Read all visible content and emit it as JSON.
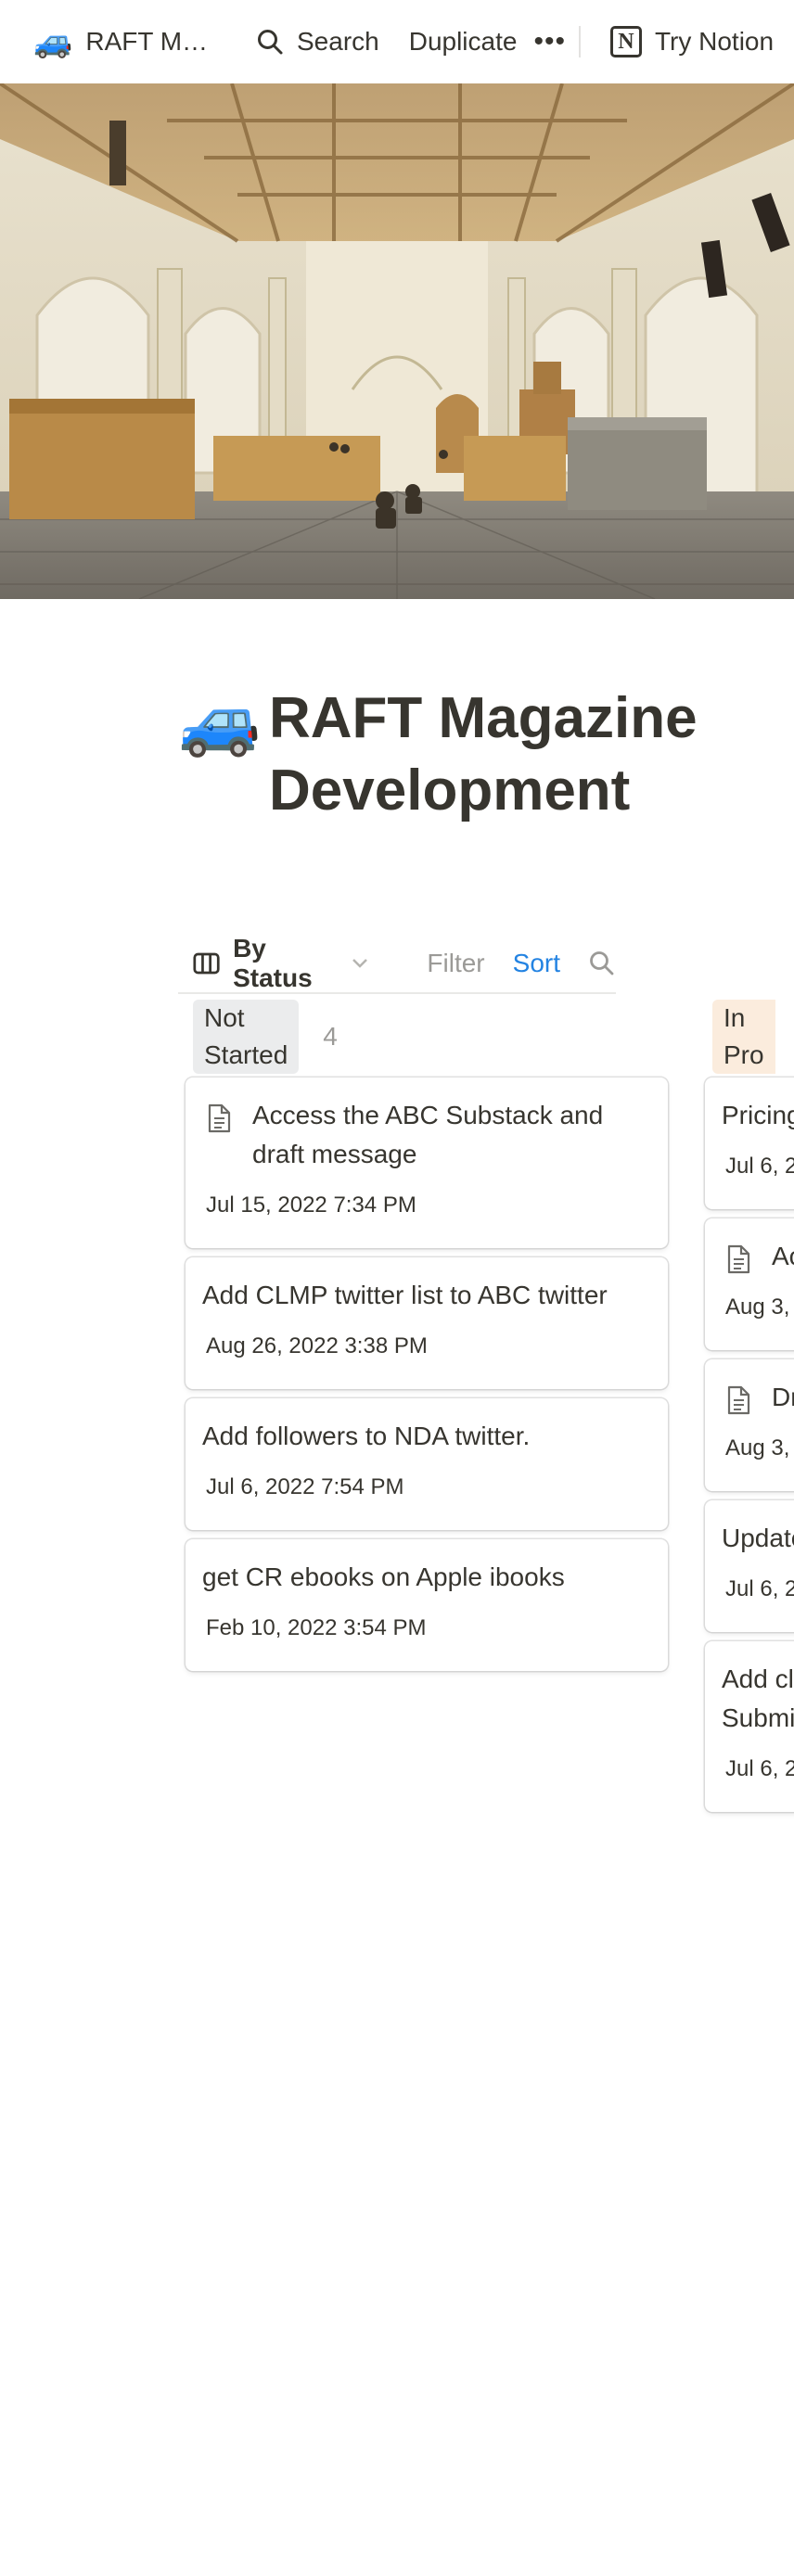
{
  "topbar": {
    "breadcrumb_emoji": "🚙",
    "breadcrumb_title": "RAFT M…",
    "search_label": "Search",
    "duplicate_label": "Duplicate",
    "more_label": "•••",
    "try_notion_label": "Try Notion",
    "notion_logo_letter": "N"
  },
  "cover": {
    "description_icon": "church-interior-painting"
  },
  "page": {
    "icon": "🚙",
    "title": "RAFT Magazine Development"
  },
  "viewbar": {
    "view_name": "By Status",
    "filter_label": "Filter",
    "sort_label": "Sort"
  },
  "board": {
    "groups": [
      {
        "status": "Not Started",
        "status_color": "#ebeced",
        "count": "4",
        "cards": [
          {
            "title": "Access the ABC Substack and draft message",
            "date": "Jul 15, 2022 7:34 PM",
            "has_doc_icon": true
          },
          {
            "title": "Add CLMP twitter list to ABC twitter",
            "date": "Aug 26, 2022 3:38 PM",
            "has_doc_icon": false
          },
          {
            "title": "Add followers to NDA twitter.",
            "date": "Jul 6, 2022 7:54 PM",
            "has_doc_icon": false
          },
          {
            "title": "get CR ebooks on Apple ibooks",
            "date": "Feb 10, 2022 3:54 PM",
            "has_doc_icon": false
          }
        ]
      },
      {
        "status": "In Pro",
        "status_color": "#fbecdd",
        "cards": [
          {
            "title": "Pricing",
            "date": "Jul 6, 2",
            "has_doc_icon": false
          },
          {
            "title": "Ac",
            "date": "Aug 3,",
            "has_doc_icon": true
          },
          {
            "title": "Dr",
            "date": "Aug 3,",
            "has_doc_icon": true
          },
          {
            "title": "Update",
            "date": "Jul 6, 2",
            "has_doc_icon": false
          },
          {
            "title": "Add cl Submi",
            "date": "Jul 6, 2",
            "has_doc_icon": false
          }
        ]
      }
    ]
  },
  "colors": {
    "text": "#37352f",
    "muted": "#9b9a97",
    "accent_blue": "#2383e2"
  }
}
